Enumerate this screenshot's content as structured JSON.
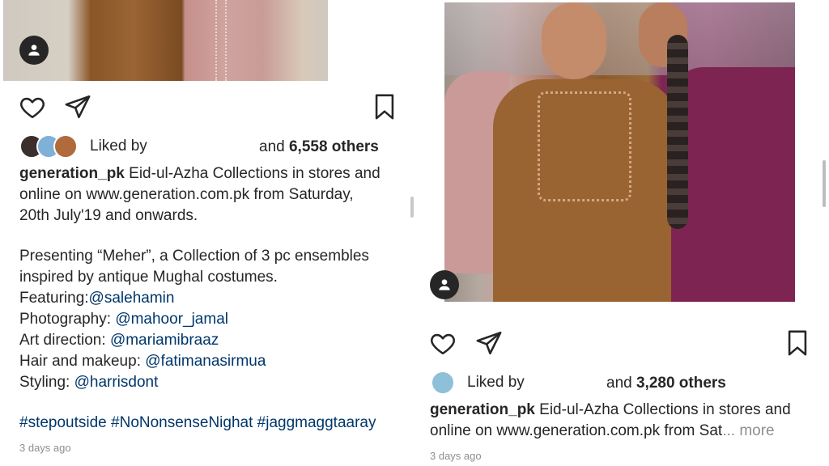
{
  "left_post": {
    "liked_by_label": "Liked by",
    "likes_prefix": "and",
    "likes_count": "6,558 others",
    "caption": {
      "username": "generation_pk",
      "line1": "Eid-ul-Azha Collections in stores and",
      "line2": "online on www.generation.com.pk from Saturday,",
      "line3": "20th July'19 and onwards.",
      "line4": "Presenting “Meher”, a Collection of 3 pc ensembles",
      "line5": "inspired by antique Mughal costumes.",
      "featuring_label": "Featuring:",
      "featuring_handle": "@salehamin",
      "photography_label": "Photography: ",
      "photography_handle": "@mahoor_jamal",
      "art_label": "Art direction: ",
      "art_handle": "@mariamibraaz",
      "hair_label": "Hair and makeup: ",
      "hair_handle": "@fatimanasirmua",
      "styling_label": "Styling: ",
      "styling_handle": "@harrisdont",
      "hashtag1": "#stepoutside",
      "hashtag2": "#NoNonsenseNighat",
      "hashtag3": "#jaggmaggtaaray"
    },
    "timestamp": "3 days ago"
  },
  "right_post": {
    "liked_by_label": "Liked by",
    "likes_prefix": "and",
    "likes_count": "3,280 others",
    "caption": {
      "username": "generation_pk",
      "line1": "Eid-ul-Azha Collections in stores and",
      "line2": "online on www.generation.com.pk from Sat",
      "ellipsis": "...",
      "more_label": "more"
    },
    "timestamp": "3 days ago"
  },
  "icons": {
    "like": "heart-icon",
    "share": "paper-plane-icon",
    "save": "bookmark-icon",
    "user_tag": "person-icon"
  },
  "colors": {
    "text": "#262626",
    "mention": "#00376b",
    "muted": "#8e8e8e",
    "tag_bg": "#262626"
  }
}
